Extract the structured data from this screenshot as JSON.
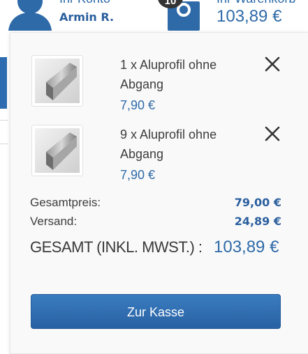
{
  "header": {
    "account_label": "Ihr Konto",
    "account_name": "Armin R.",
    "cart_label": "Ihr Warenkorb",
    "cart_count": "10",
    "cart_total": "103,89 €"
  },
  "cart": {
    "items": [
      {
        "name": "1 x Aluprofil ohne Abgang",
        "price": "7,90 €"
      },
      {
        "name": "9 x Aluprofil ohne Abgang",
        "price": "7,90 €"
      }
    ],
    "subtotal_label": "Gesamtpreis:",
    "subtotal_value": "79,00 €",
    "shipping_label": "Versand:",
    "shipping_value": "24,89 €",
    "grand_label": "GESAMT (INKL. MWST.) :",
    "grand_value": "103,89 €",
    "checkout_label": "Zur Kasse"
  },
  "colors": {
    "accent": "#2e6aa8",
    "button": "#2d6cb0"
  },
  "icons": [
    "user-icon",
    "shopping-bag-icon",
    "close-icon",
    "product-thumbnail"
  ]
}
